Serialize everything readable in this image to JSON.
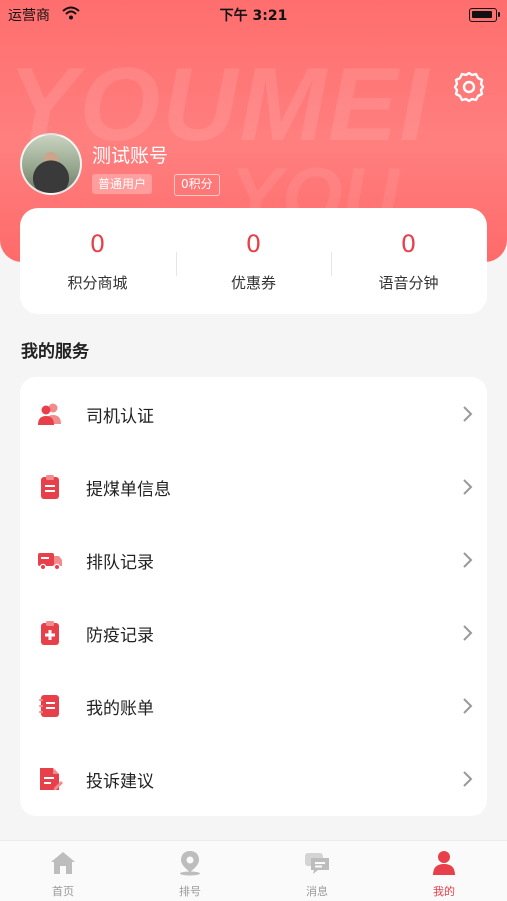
{
  "status_bar": {
    "carrier": "运营商",
    "time": "下午 3:21"
  },
  "header": {
    "watermark": "YOUMEI",
    "watermark2": "YOU",
    "username": "测试账号",
    "level_badge": "普通用户",
    "points_badge": "0积分",
    "icons": {
      "settings": "gear-icon",
      "avatar": "avatar-image"
    }
  },
  "stats": [
    {
      "value": "0",
      "label": "积分商城"
    },
    {
      "value": "0",
      "label": "优惠券"
    },
    {
      "value": "0",
      "label": "语音分钟"
    }
  ],
  "services": {
    "title": "我的服务",
    "items": [
      {
        "label": "司机认证",
        "icon": "driver-users-icon"
      },
      {
        "label": "提煤单信息",
        "icon": "clipboard-icon"
      },
      {
        "label": "排队记录",
        "icon": "truck-icon"
      },
      {
        "label": "防疫记录",
        "icon": "medical-clipboard-icon"
      },
      {
        "label": "我的账单",
        "icon": "bill-icon"
      },
      {
        "label": "投诉建议",
        "icon": "document-edit-icon"
      }
    ]
  },
  "tabbar": {
    "items": [
      {
        "label": "首页",
        "icon": "home-icon",
        "active": false
      },
      {
        "label": "排号",
        "icon": "location-pin-icon",
        "active": false
      },
      {
        "label": "消息",
        "icon": "message-icon",
        "active": false
      },
      {
        "label": "我的",
        "icon": "user-icon",
        "active": true
      }
    ]
  },
  "colors": {
    "accent": "#e8404a",
    "header": "#ff7070",
    "inactive": "#9a9a9a"
  }
}
